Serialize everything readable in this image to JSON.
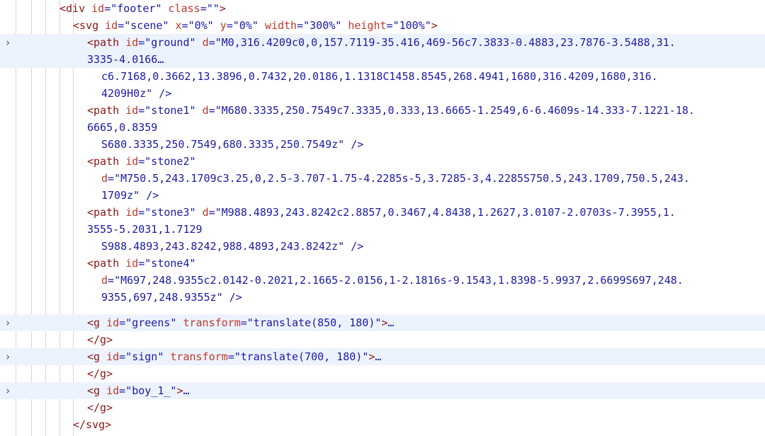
{
  "lines": [
    {
      "text": "<div id=\"footer\" class=\"\">"
    },
    {
      "text": "<svg id=\"scene\" x=\"0%\" y=\"0%\" width=\"300%\" height=\"100%\">"
    },
    {
      "text": "<path id=\"ground\" d=\"M0,316.4209c0,0,157.7119-35.416,469-56c7.3833-0.4883,23.7876-3.5488,31."
    },
    {
      "text": "3335-4.0166",
      "ellipsis": "…"
    },
    {
      "text": "c6.7168,0.3662,13.3896,0.7432,20.0186,1.1318C1458.8545,268.4941,1680,316.4209,1680,316."
    },
    {
      "text": "4209H0z\" />"
    },
    {
      "text": "<path id=\"stone1\" d=\"M680.3335,250.7549c7.3335,0.333,13.6665-1.2549,6-6.4609s-14.333-7.1221-18."
    },
    {
      "text": "6665,0.8359"
    },
    {
      "text": "S680.3335,250.7549,680.3335,250.7549z\" />"
    },
    {
      "text": "<path id=\"stone2\""
    },
    {
      "text": "d=\"M750.5,243.1709c3.25,0,2.5-3.707-1.75-4.2285s-5,3.7285-3,4.2285S750.5,243.1709,750.5,243."
    },
    {
      "text": "1709z\" />"
    },
    {
      "text": "<path id=\"stone3\" d=\"M988.4893,243.8242c2.8857,0.3467,4.8438,1.2627,3.0107-2.0703s-7.3955,1."
    },
    {
      "text": "3555-5.2031,1.7129"
    },
    {
      "text": "S988.4893,243.8242,988.4893,243.8242z\" />"
    },
    {
      "text": "<path id=\"stone4\""
    },
    {
      "text": "d=\"M697,248.9355c2.0142-0.2021,2.1665-2.0156,1-2.1816s-9.1543,1.8398-5.9937,2.6699S697,248."
    },
    {
      "text": "9355,697,248.9355z\" />"
    },
    {
      "text": "<g id=\"greens\" transform=\"translate(850, 180)\">",
      "ellipsis": "…"
    },
    {
      "text": "</g>"
    },
    {
      "text": "<g id=\"sign\" transform=\"translate(700, 180)\">",
      "ellipsis": "…"
    },
    {
      "text": "</g>"
    },
    {
      "text": "<g id=\"boy_1_\">",
      "ellipsis": "…"
    },
    {
      "text": "</g>"
    },
    {
      "text": "</svg>"
    }
  ],
  "expand_arrow": "›"
}
